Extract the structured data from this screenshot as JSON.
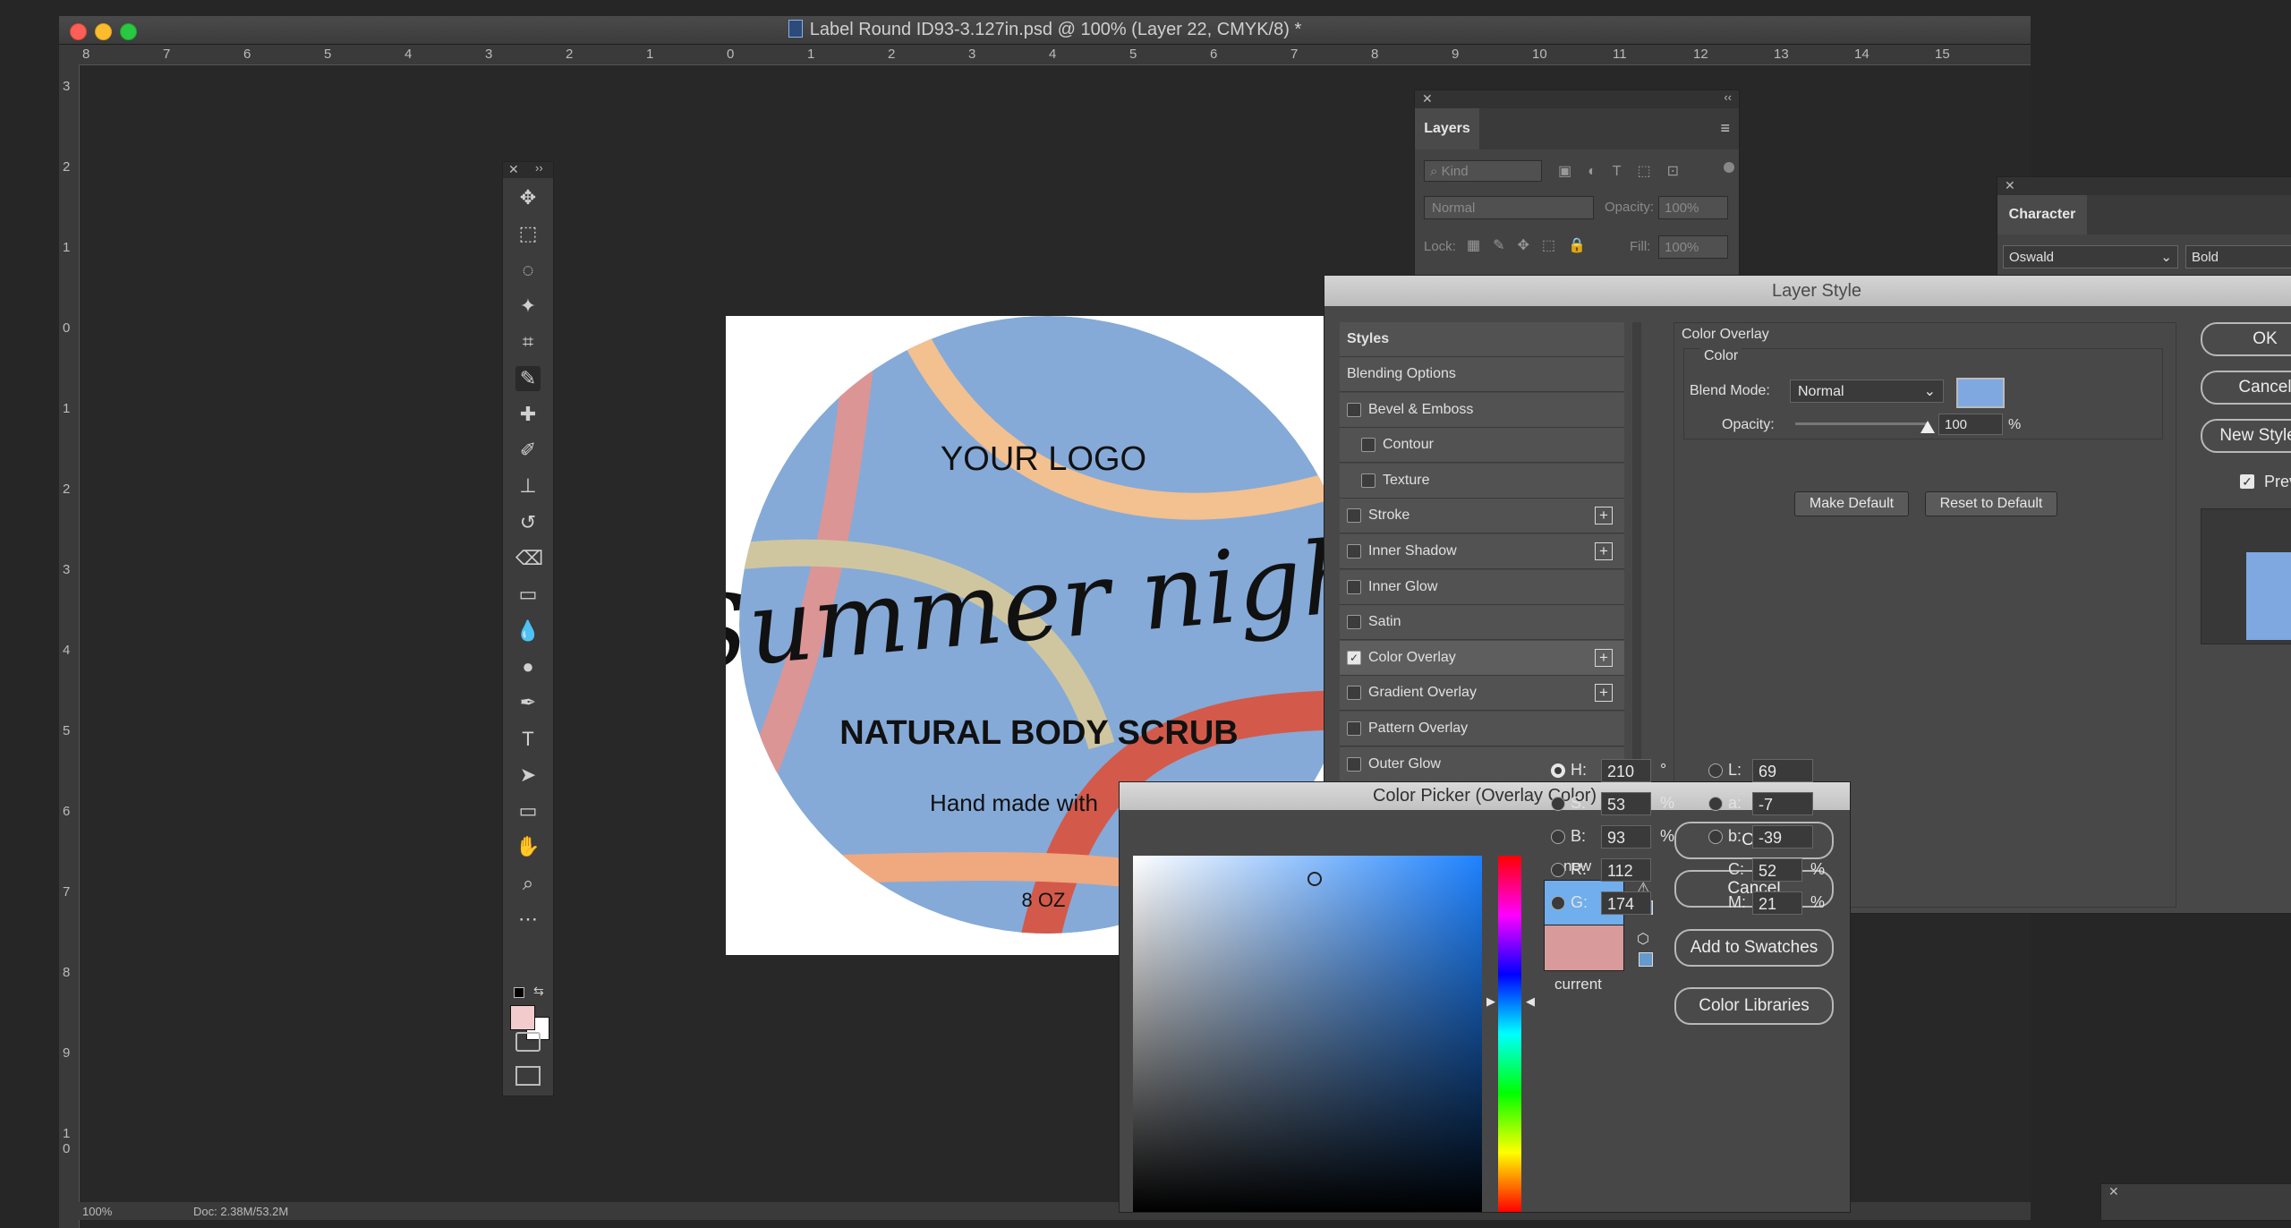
{
  "window": {
    "title": "Label Round ID93-3.127in.psd @ 100% (Layer 22, CMYK/8) *",
    "zoom": "100%",
    "status": "Doc: 2.38M/53.2M"
  },
  "rulers": {
    "horizontal": [
      "8",
      "7",
      "6",
      "5",
      "4",
      "3",
      "2",
      "1",
      "0",
      "1",
      "2",
      "3",
      "4",
      "5",
      "6",
      "7",
      "8",
      "9",
      "10",
      "11",
      "12",
      "13",
      "14",
      "15"
    ],
    "vertical": [
      "3",
      "2",
      "1",
      "0",
      "1",
      "2",
      "3",
      "4",
      "5",
      "6",
      "7",
      "8",
      "9",
      "1 0"
    ]
  },
  "label_art": {
    "logo_text": "YOUR LOGO",
    "script_title": "Summer night",
    "subtitle": "NATURAL BODY SCRUB",
    "tagline": "Hand made with",
    "weight": "8 OZ",
    "colors": {
      "base": "#85aad8",
      "pink": "#dc9595",
      "peach": "#f3c08f",
      "tan": "#cfc6a0",
      "red": "#d35a4a",
      "orange": "#f0a87e"
    }
  },
  "toolbox": {
    "tools": [
      "move-icon",
      "marquee-icon",
      "lasso-icon",
      "magic-wand-icon",
      "crop-icon",
      "eyedropper-icon",
      "healing-brush-icon",
      "brush-icon",
      "stamp-icon",
      "history-brush-icon",
      "eraser-icon",
      "gradient-icon",
      "blur-icon",
      "dodge-icon",
      "pen-icon",
      "type-icon",
      "path-selection-icon",
      "rectangle-icon",
      "hand-icon",
      "zoom-icon",
      "more-icon"
    ],
    "foreground_color": "#f2cccc",
    "background_color": "#ffffff"
  },
  "layers_panel": {
    "tab": "Layers",
    "filter_placeholder": "Kind",
    "blend_mode": "Normal",
    "opacity_label": "Opacity:",
    "opacity_value": "100%",
    "lock_label": "Lock:",
    "fill_label": "Fill:",
    "fill_value": "100%"
  },
  "character_panel": {
    "tab": "Character",
    "font_family": "Oswald",
    "font_style": "Bold"
  },
  "layer_style": {
    "title": "Layer Style",
    "styles_header": "Styles",
    "items": [
      {
        "label": "Blending Options",
        "checkbox": false,
        "checked": false,
        "plus": false,
        "indent": false
      },
      {
        "label": "Bevel & Emboss",
        "checkbox": true,
        "checked": false,
        "plus": false,
        "indent": false
      },
      {
        "label": "Contour",
        "checkbox": true,
        "checked": false,
        "plus": false,
        "indent": true
      },
      {
        "label": "Texture",
        "checkbox": true,
        "checked": false,
        "plus": false,
        "indent": true
      },
      {
        "label": "Stroke",
        "checkbox": true,
        "checked": false,
        "plus": true,
        "indent": false
      },
      {
        "label": "Inner Shadow",
        "checkbox": true,
        "checked": false,
        "plus": true,
        "indent": false
      },
      {
        "label": "Inner Glow",
        "checkbox": true,
        "checked": false,
        "plus": false,
        "indent": false
      },
      {
        "label": "Satin",
        "checkbox": true,
        "checked": false,
        "plus": false,
        "indent": false
      },
      {
        "label": "Color Overlay",
        "checkbox": true,
        "checked": true,
        "plus": true,
        "indent": false
      },
      {
        "label": "Gradient Overlay",
        "checkbox": true,
        "checked": false,
        "plus": true,
        "indent": false
      },
      {
        "label": "Pattern Overlay",
        "checkbox": true,
        "checked": false,
        "plus": false,
        "indent": false
      },
      {
        "label": "Outer Glow",
        "checkbox": true,
        "checked": false,
        "plus": false,
        "indent": false
      }
    ],
    "section_title": "Color Overlay",
    "group_title": "Color",
    "blend_mode_label": "Blend Mode:",
    "blend_mode_value": "Normal",
    "overlay_color": "#7fa8e0",
    "opacity_label": "Opacity:",
    "opacity_value": "100",
    "opacity_unit": "%",
    "make_default": "Make Default",
    "reset_default": "Reset to Default",
    "right_buttons": [
      "OK",
      "Cancel",
      "New Style..."
    ],
    "preview_label": "Preview",
    "preview_checked": true
  },
  "color_picker": {
    "title": "Color Picker (Overlay Color)",
    "new_label": "new",
    "current_label": "current",
    "new_color": "#70aeed",
    "current_color": "#d89a9a",
    "buttons": {
      "ok": "OK",
      "cancel": "Cancel",
      "add": "Add to Swatches",
      "libraries": "Color Libraries"
    },
    "hsb": [
      {
        "key": "H:",
        "value": "210",
        "unit": "°",
        "selected": true
      },
      {
        "key": "S:",
        "value": "53",
        "unit": "%",
        "selected": false
      },
      {
        "key": "B:",
        "value": "93",
        "unit": "%",
        "selected": false
      },
      {
        "key": "R:",
        "value": "112",
        "unit": "",
        "selected": false
      },
      {
        "key": "G:",
        "value": "174",
        "unit": "",
        "selected": false
      }
    ],
    "lab": [
      {
        "key": "L:",
        "value": "69"
      },
      {
        "key": "a:",
        "value": "-7"
      },
      {
        "key": "b:",
        "value": "-39"
      }
    ],
    "cmyk": [
      {
        "key": "C:",
        "value": "52",
        "unit": "%"
      },
      {
        "key": "M:",
        "value": "21",
        "unit": "%"
      }
    ]
  }
}
